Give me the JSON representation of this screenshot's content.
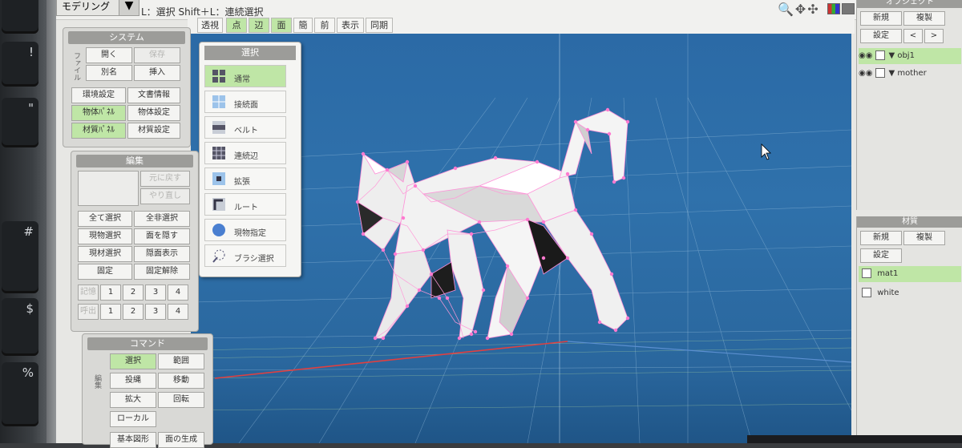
{
  "keyboard_keys": [
    {
      "label": ""
    },
    {
      "label": "!"
    },
    {
      "label": "\""
    },
    {
      "label": "#"
    },
    {
      "label": "$"
    },
    {
      "label": "%"
    }
  ],
  "topbar": {
    "mode": "モデリング",
    "hint": "L：選択  Shift＋L：連続選択"
  },
  "view_tabs": [
    {
      "label": "透視",
      "active": false
    },
    {
      "label": "点",
      "active": true
    },
    {
      "label": "辺",
      "active": true
    },
    {
      "label": "面",
      "active": true
    },
    {
      "label": "簡",
      "active": false
    },
    {
      "label": "前",
      "active": false
    },
    {
      "label": "表示",
      "active": false
    },
    {
      "label": "同期",
      "active": false
    }
  ],
  "system_panel": {
    "title": "システム",
    "file_label": "ファイル",
    "open": "開く",
    "save": "保存",
    "save_as": "別名",
    "insert": "挿入",
    "env_settings": "環境設定",
    "doc_info": "文書情報",
    "object_panel": "物体ﾊﾟﾈﾙ",
    "object_settings": "物体設定",
    "material_panel": "材質ﾊﾟﾈﾙ",
    "material_settings": "材質設定"
  },
  "edit_panel": {
    "title": "編集",
    "undo": "元に戻す",
    "redo": "やり直し",
    "select_all": "全て選択",
    "deselect_all": "全非選択",
    "select_current_object": "現物選択",
    "hide_face": "面を隠す",
    "select_current_material": "現材選択",
    "show_hidden": "隠面表示",
    "fix": "固定",
    "unfix": "固定解除",
    "memory_label": "記憶",
    "recall_label": "呼出",
    "slots": [
      "1",
      "2",
      "3",
      "4"
    ]
  },
  "command_panel": {
    "title": "コマンド",
    "side_label": "編集",
    "select": "選択",
    "range": "範囲",
    "project": "投縄",
    "move": "移動",
    "scale": "拡大",
    "rotate": "回転",
    "local": "ローカル",
    "basic_shape": "基本図形",
    "generate_face": "面の生成"
  },
  "select_popup": {
    "title": "選択",
    "items": [
      {
        "label": "通常",
        "icon": "grid-select-icon",
        "active": true
      },
      {
        "label": "接続面",
        "icon": "connected-face-icon",
        "active": false
      },
      {
        "label": "ベルト",
        "icon": "belt-icon",
        "active": false
      },
      {
        "label": "連続辺",
        "icon": "edge-loop-icon",
        "active": false
      },
      {
        "label": "拡張",
        "icon": "expand-icon",
        "active": false
      },
      {
        "label": "ルート",
        "icon": "route-icon",
        "active": false
      },
      {
        "label": "現物指定",
        "icon": "sphere-icon",
        "active": false
      },
      {
        "label": "ブラシ選択",
        "icon": "brush-icon",
        "active": false
      }
    ]
  },
  "object_panel": {
    "title": "オブジェクト",
    "new": "新規",
    "duplicate": "複製",
    "settings": "設定",
    "prev": "<",
    "next": ">",
    "objects": [
      {
        "name": "obj1",
        "selected": true
      },
      {
        "name": "mother",
        "selected": false
      }
    ]
  },
  "material_panel": {
    "title": "材質",
    "new": "新規",
    "duplicate": "複製",
    "settings": "設定",
    "materials": [
      {
        "name": "mat1",
        "selected": true
      },
      {
        "name": "white",
        "selected": false
      }
    ]
  },
  "colors": {
    "active_green": "#bfe6a6",
    "viewport_blue": "#2f71ab",
    "vertex_pink": "#ff8fd8"
  }
}
